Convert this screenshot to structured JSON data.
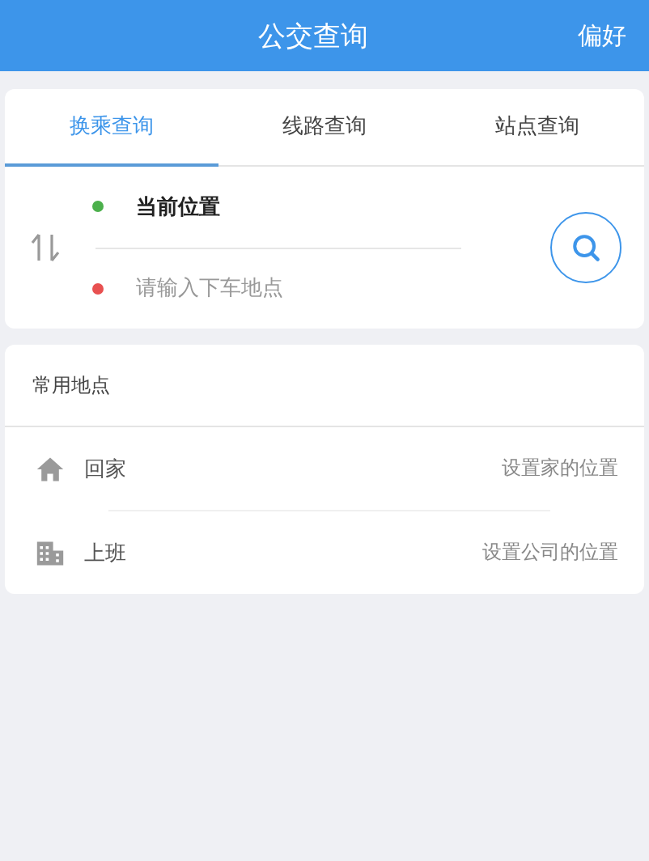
{
  "header": {
    "title": "公交查询",
    "action": "偏好"
  },
  "tabs": [
    {
      "label": "换乘查询",
      "selected": true
    },
    {
      "label": "线路查询",
      "selected": false
    },
    {
      "label": "站点查询",
      "selected": false
    }
  ],
  "stops": [
    {
      "value": "当前位置",
      "color": "#4cb04c"
    },
    {
      "placeholder": "请输入下车地点",
      "color": "#e85050"
    }
  ],
  "places": {
    "title": "常用地点",
    "items": [
      {
        "kind": "home",
        "label": "回家",
        "hint": "设置家的位置"
      },
      {
        "kind": "office",
        "label": "上班",
        "hint": "设置公司的位置"
      }
    ]
  }
}
